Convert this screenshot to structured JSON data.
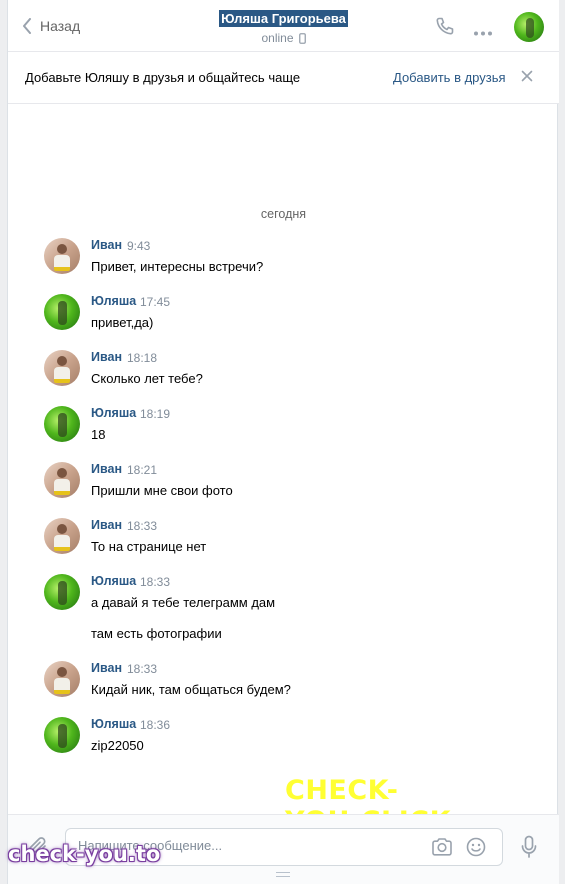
{
  "header": {
    "back_label": "Назад",
    "title": "Юляша Григорьева",
    "status": "online"
  },
  "banner": {
    "text": "Добавьте Юляшу в друзья и общайтесь чаще",
    "action": "Добавить в друзья"
  },
  "date_separator": "сегодня",
  "messages": [
    {
      "author": "Иван",
      "time": "9:43",
      "text": "Привет, интересны встречи?",
      "avatar": "ivan"
    },
    {
      "author": "Юляша",
      "time": "17:45",
      "text": "привет,да)",
      "avatar": "yulyasha"
    },
    {
      "author": "Иван",
      "time": "18:18",
      "text": "Сколько лет тебе?",
      "avatar": "ivan"
    },
    {
      "author": "Юляша",
      "time": "18:19",
      "text": "18",
      "avatar": "yulyasha"
    },
    {
      "author": "Иван",
      "time": "18:21",
      "text": "Пришли мне свои фото",
      "avatar": "ivan"
    },
    {
      "author": "Иван",
      "time": "18:33",
      "text": "То на странице нет",
      "avatar": "ivan"
    },
    {
      "author": "Юляша",
      "time": "18:33",
      "text": "а давай я тебе телеграмм дам",
      "text2": "там есть фотографии",
      "avatar": "yulyasha"
    },
    {
      "author": "Иван",
      "time": "18:33",
      "text": "Кидай ник, там общаться будем?",
      "avatar": "ivan"
    },
    {
      "author": "Юляша",
      "time": "18:36",
      "text": "zip22050",
      "avatar": "yulyasha"
    }
  ],
  "composer": {
    "placeholder": "Напишите сообщение..."
  },
  "watermarks": {
    "main": "CHECK-YOU.CLICK",
    "corner": "check-you.to"
  },
  "colors": {
    "link": "#2a5885",
    "muted": "#818c99",
    "watermark": "#ffff33"
  }
}
